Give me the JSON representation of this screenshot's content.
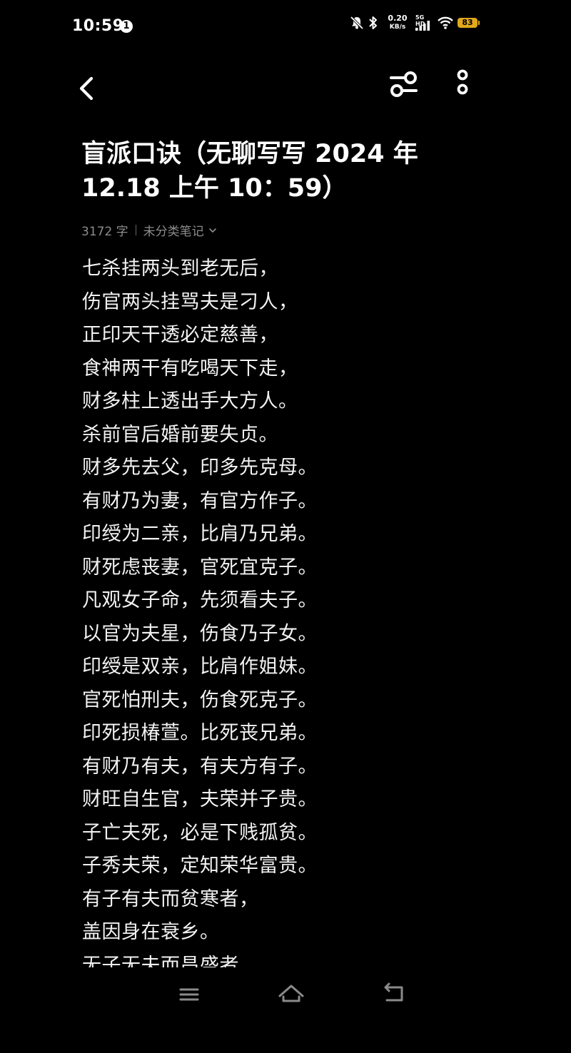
{
  "status_bar": {
    "time": "10:59",
    "notification_badge": "1",
    "net_speed_value": "0.20",
    "net_speed_unit": "KB/s",
    "network_type": "5G HD",
    "battery_level": "83",
    "battery_color": "#e0a81c",
    "icons": [
      "mute-icon",
      "bluetooth-icon",
      "signal-icon",
      "wifi-icon",
      "battery-icon"
    ]
  },
  "toolbar": {
    "icons": [
      "back-icon",
      "adjust-icon",
      "more-icon"
    ]
  },
  "note": {
    "title": "盲派口诀（无聊写写 2024 年 12.18 上午 10：59）",
    "word_count": "3172 字",
    "category": "未分类笔记",
    "lines": [
      "七杀挂两头到老无后，",
      "伤官两头挂骂夫是刁人，",
      "正印天干透必定慈善，",
      "食神两干有吃喝天下走，",
      "财多柱上透出手大方人。",
      "杀前官后婚前要失贞。",
      "财多先去父，印多先克母。",
      "有财乃为妻，有官方作子。",
      "印绶为二亲，比肩乃兄弟。",
      "财死虑丧妻，官死宜克子。",
      "凡观女子命，先须看夫子。",
      "以官为夫星，伤食乃子女。",
      "印绶是双亲，比肩作姐妹。",
      "官死怕刑夫，伤食死克子。",
      "印死损椿萱。比死丧兄弟。",
      "有财乃有夫，有夫方有子。",
      "财旺自生官，夫荣并子贵。",
      "子亡夫死，必是下贱孤贫。",
      "子秀夫荣，定知荣华富贵。",
      "有子有夫而贫寒者，",
      "盖因身在衰乡。",
      "无子无夫而昌盛者"
    ]
  },
  "nav_bar": {
    "icons": [
      "menu-icon",
      "home-icon",
      "back-nav-icon"
    ]
  }
}
